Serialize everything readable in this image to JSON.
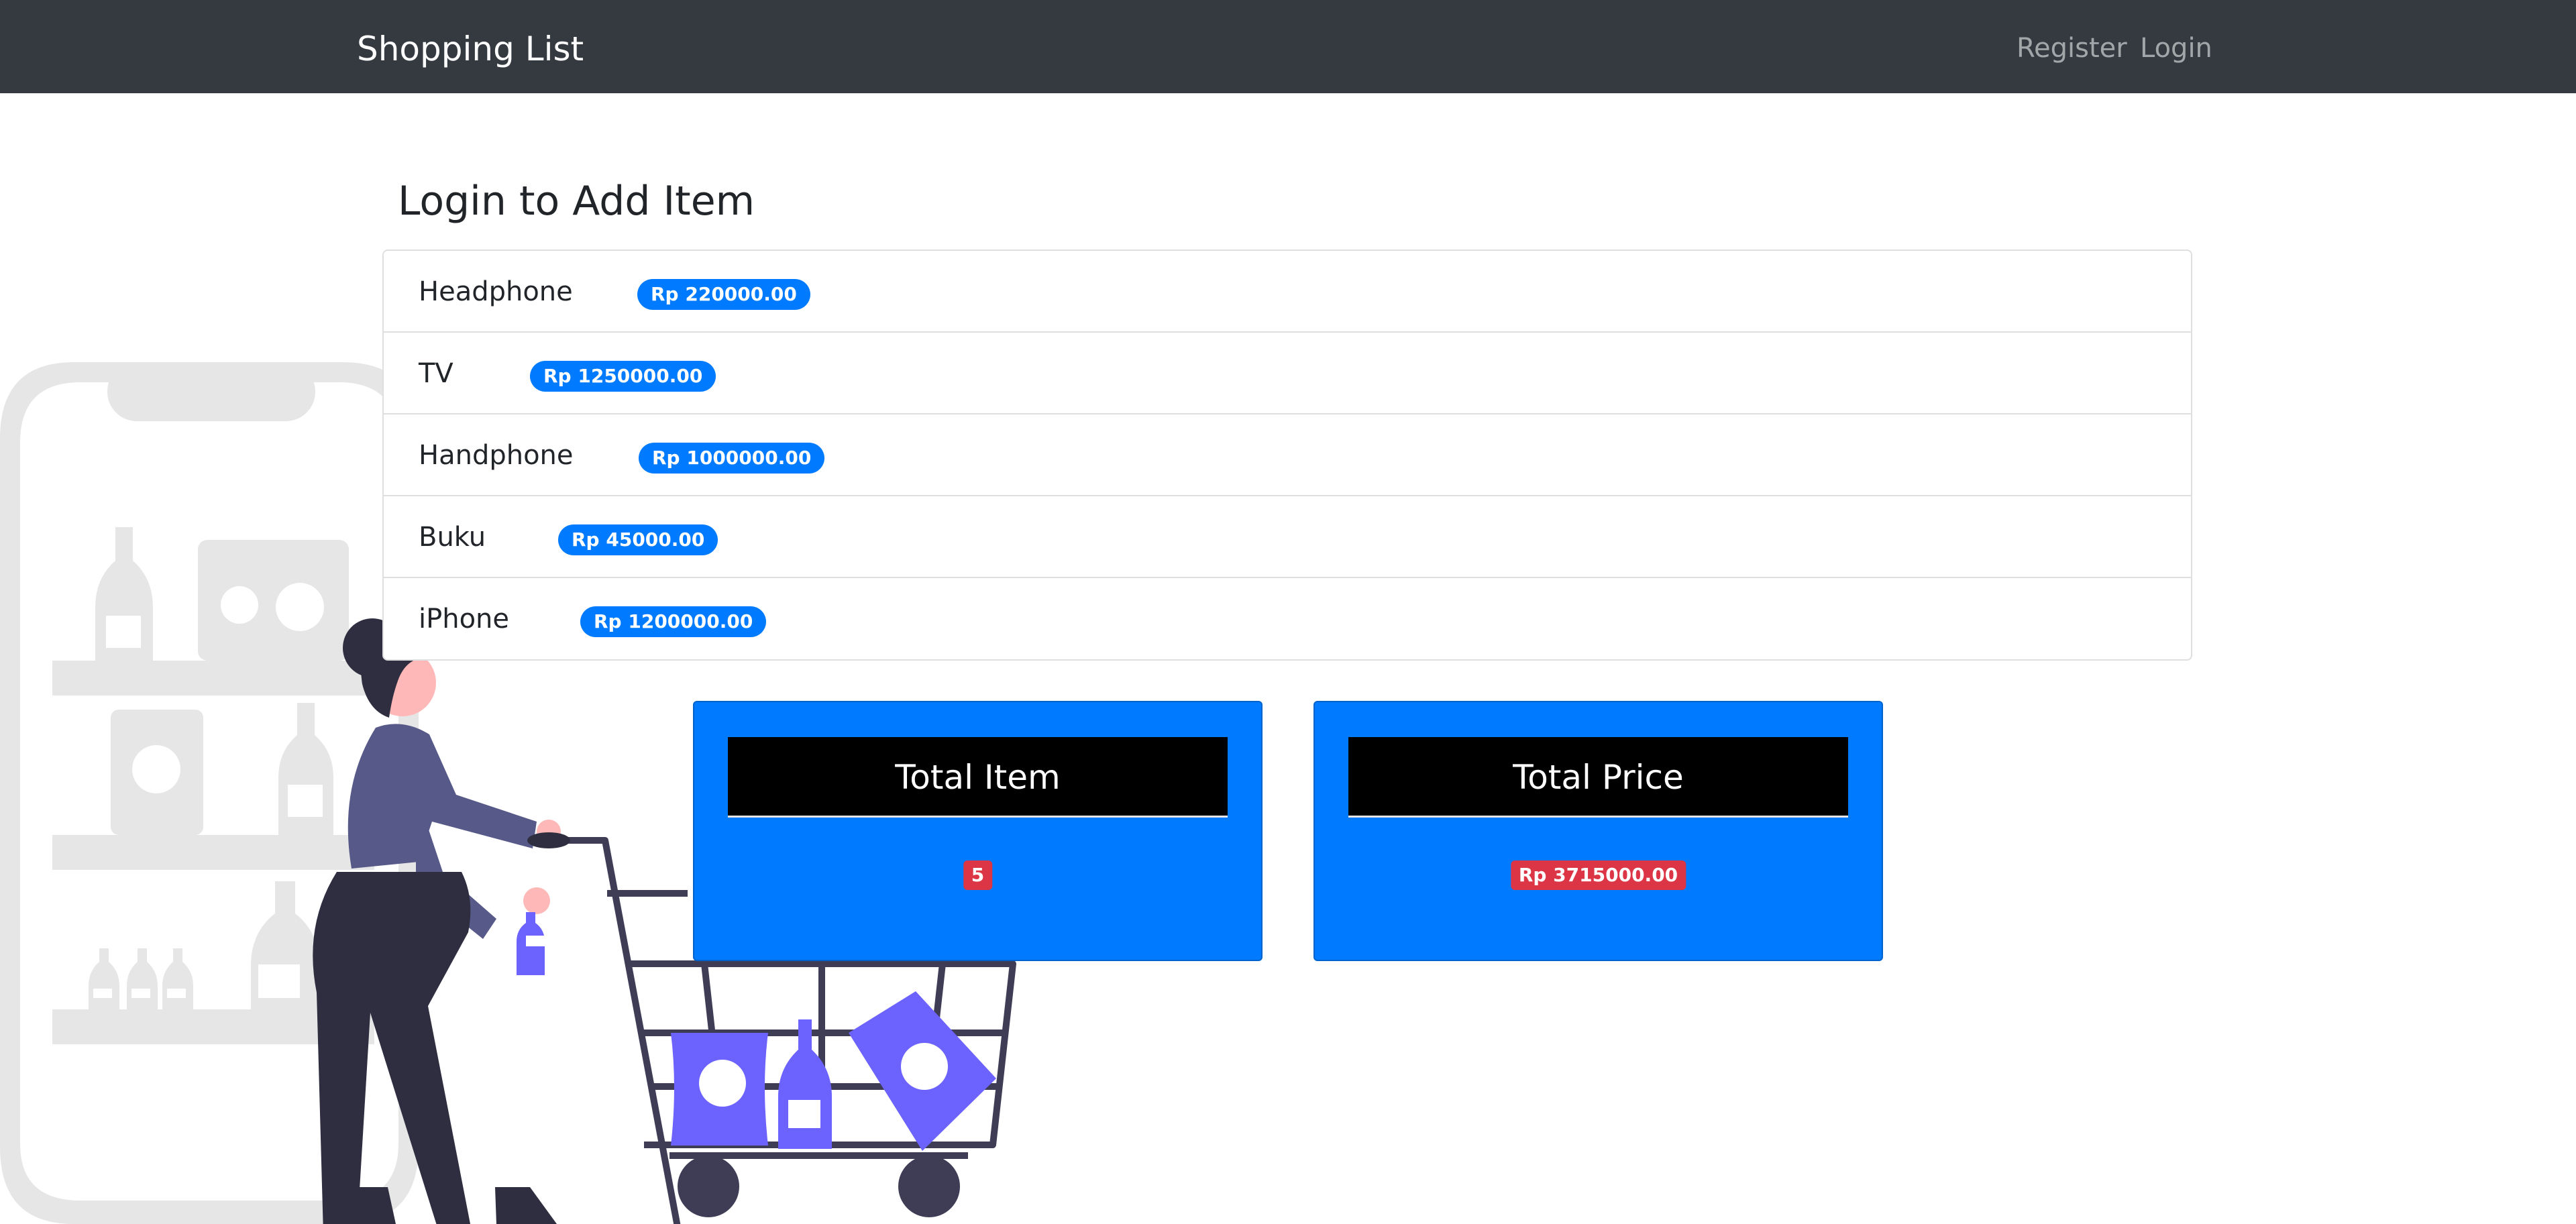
{
  "navbar": {
    "brand": "Shopping List",
    "links": {
      "register": "Register",
      "login": "Login"
    }
  },
  "main": {
    "heading": "Login to Add Item",
    "items": [
      {
        "name": "Headphone",
        "price": "Rp 220000.00"
      },
      {
        "name": "TV",
        "price": "Rp 1250000.00"
      },
      {
        "name": "Handphone",
        "price": "Rp 1000000.00"
      },
      {
        "name": "Buku",
        "price": "Rp 45000.00"
      },
      {
        "name": "iPhone",
        "price": "Rp 1200000.00"
      }
    ]
  },
  "summary": {
    "total_item": {
      "title": "Total Item",
      "value": "5"
    },
    "total_price": {
      "title": "Total Price",
      "value": "Rp 3715000.00"
    }
  },
  "illustration": {
    "name": "shopping-cart-illustration"
  },
  "colors": {
    "navbar": "#343a40",
    "primary": "#007bff",
    "danger": "#dc3545",
    "illustration_accent": "#6c63ff",
    "illustration_gray": "#e6e6e6"
  }
}
